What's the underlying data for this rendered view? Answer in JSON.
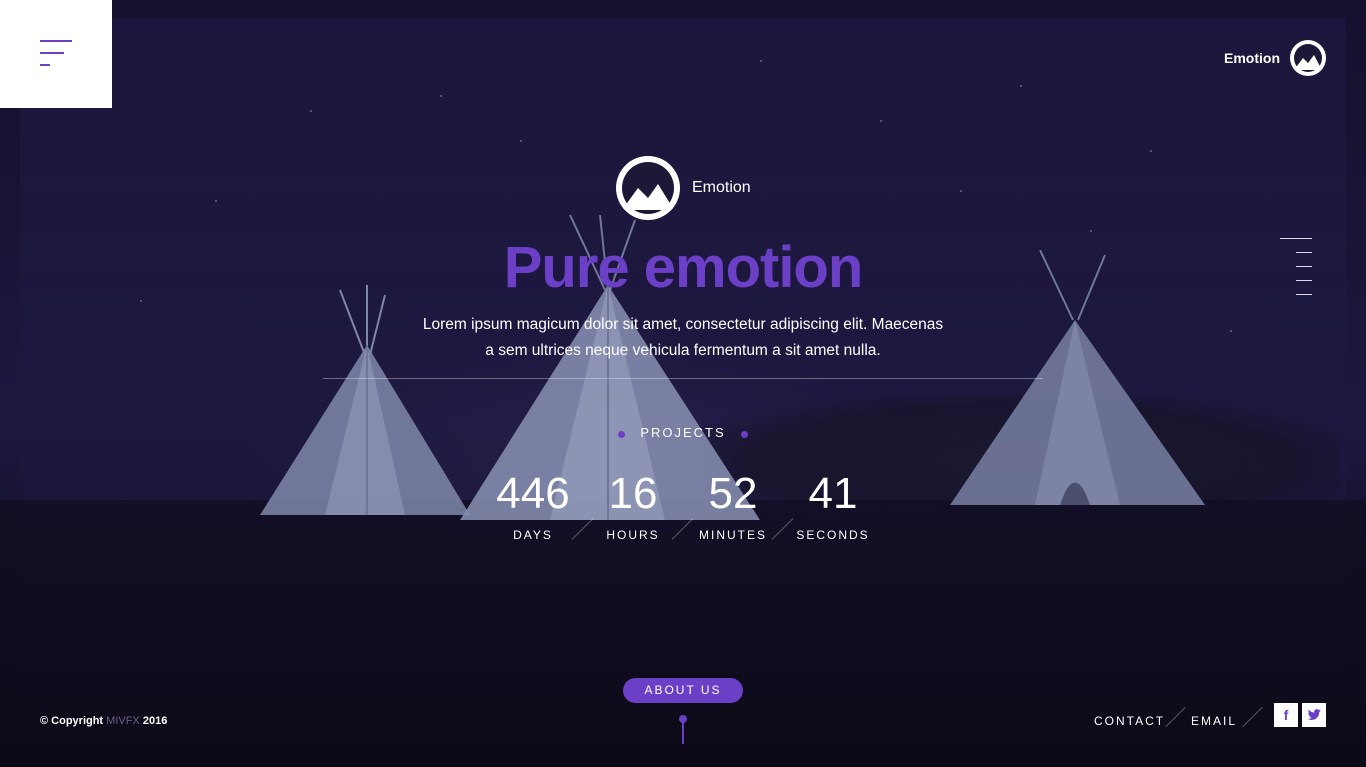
{
  "brand": {
    "name": "Emotion"
  },
  "hero": {
    "logo_text": "Emotion",
    "headline_light": "Pure ",
    "headline_bold": "emotion",
    "lead_line1": "Lorem ipsum magicum dolor sit amet, consectetur adipiscing elit. Maecenas",
    "lead_line2": "a sem ultrices neque vehicula fermentum a sit amet nulla."
  },
  "counter": {
    "title": "PROJECTS",
    "units": [
      {
        "value": "446",
        "label": "DAYS"
      },
      {
        "value": "16",
        "label": "HOURS"
      },
      {
        "value": "52",
        "label": "MINUTES"
      },
      {
        "value": "41",
        "label": "SECONDS"
      }
    ]
  },
  "about_button": {
    "label": "ABOUT US"
  },
  "footer": {
    "copyright_prefix": "© Copyright ",
    "copyright_brand": "MIVFX",
    "copyright_year": " 2016",
    "links": [
      "CONTACT",
      "EMAIL"
    ],
    "social": [
      "f",
      "twitter"
    ]
  },
  "colors": {
    "accent": "#6b3fc6",
    "background": "#1a1538"
  },
  "icons": {
    "menu": "hamburger-menu-icon",
    "logo": "mountain-logo-icon",
    "facebook": "facebook-icon",
    "twitter": "twitter-icon"
  }
}
